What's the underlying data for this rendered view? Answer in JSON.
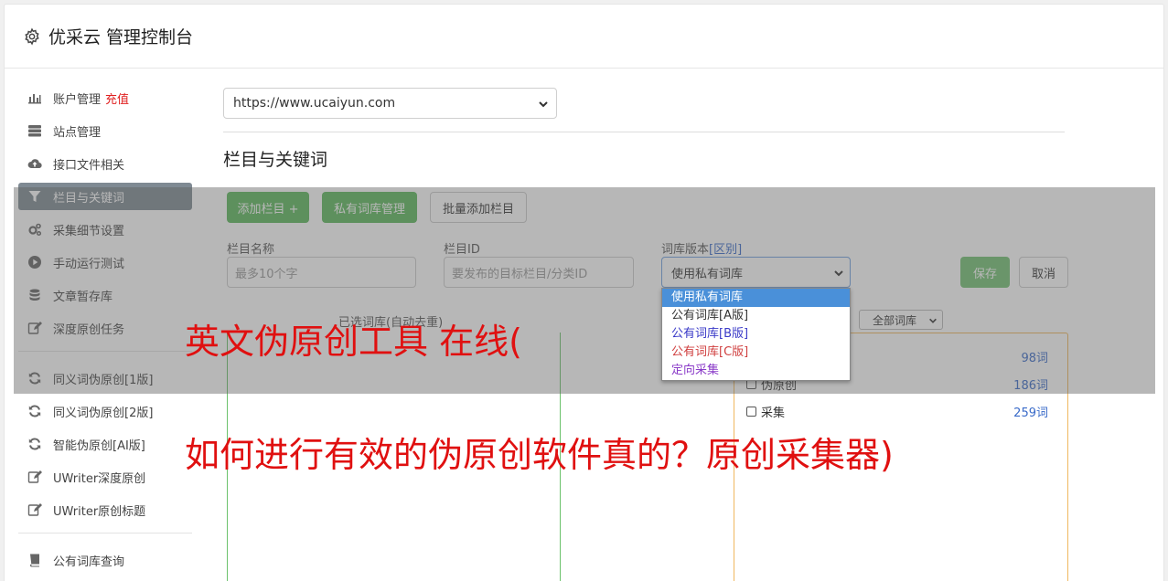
{
  "header": {
    "title": "优采云 管理控制台"
  },
  "sidebar": {
    "items": [
      {
        "label": "账户管理",
        "badge": "充值",
        "icon": "bar-chart-icon"
      },
      {
        "label": "站点管理",
        "icon": "server-icon"
      },
      {
        "label": "接口文件相关",
        "icon": "cloud-upload-icon"
      },
      {
        "label": "栏目与关键词",
        "icon": "filter-icon"
      },
      {
        "label": "采集细节设置",
        "icon": "cogs-icon"
      },
      {
        "label": "手动运行测试",
        "icon": "play-icon"
      },
      {
        "label": "文章暂存库",
        "icon": "database-icon"
      },
      {
        "label": "深度原创任务",
        "icon": "edit-icon"
      },
      {
        "label": "同义词伪原创[1版]",
        "icon": "refresh-icon"
      },
      {
        "label": "同义词伪原创[2版]",
        "icon": "refresh-icon"
      },
      {
        "label": "智能伪原创[AI版]",
        "icon": "refresh-icon"
      },
      {
        "label": "UWriter深度原创",
        "icon": "edit-icon"
      },
      {
        "label": "UWriter原创标题",
        "icon": "edit-icon"
      },
      {
        "label": "公有词库查询",
        "icon": "book-icon"
      }
    ]
  },
  "main": {
    "site_select": {
      "value": "https://www.ucaiyun.com"
    },
    "section_title": "栏目与关键词",
    "buttons": {
      "add_column": "添加栏目 +",
      "private_lib": "私有词库管理",
      "batch_add": "批量添加栏目",
      "save": "保存",
      "cancel": "取消"
    },
    "form": {
      "name_label": "栏目名称",
      "name_placeholder": "最多10个字",
      "id_label": "栏目ID",
      "id_placeholder": "要发布的目标栏目/分类ID",
      "version_label": "词库版本",
      "version_link": "[区别]",
      "version_value": "使用私有词库"
    },
    "version_options": [
      "使用私有词库",
      "公有词库[A版]",
      "公有词库[B版]",
      "公有词库[C版]",
      "定向采集"
    ],
    "version_option_colors": [
      "#ffffff",
      "#333333",
      "#3a3ac8",
      "#d04040",
      "#8a3ac8"
    ],
    "selected_words_label": "已选词库(自动去重)",
    "filter_select": "全部词库",
    "keywords": [
      {
        "name": "",
        "count": "98词"
      },
      {
        "name": "伪原创",
        "count": "186词"
      },
      {
        "name": "采集",
        "count": "259词"
      }
    ]
  },
  "overlay_text": {
    "line1": "英文伪原创工具 在线(",
    "line2": "如何进行有效的伪原创软件真的？原创采集器)"
  },
  "colors": {
    "accent_green": "#5cb85c",
    "active_sidebar": "#7f8a93",
    "red_overlay_text": "#e01010",
    "link_blue": "#3a6bc9"
  }
}
